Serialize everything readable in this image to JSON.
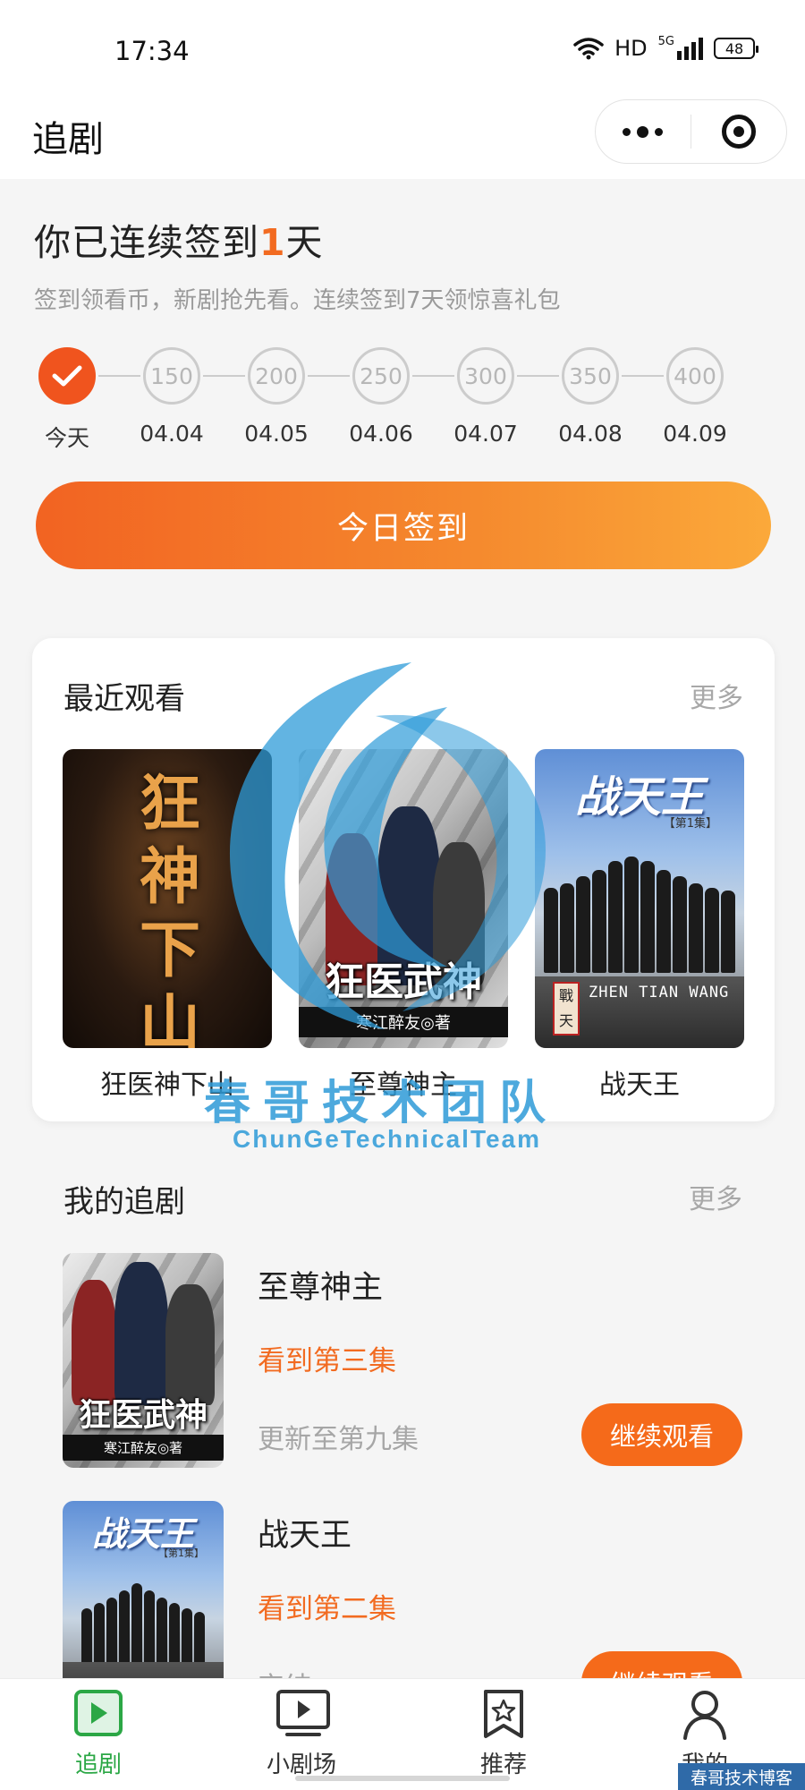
{
  "status_bar": {
    "time": "17:34",
    "network": "HD",
    "signal": "5G",
    "battery": "48"
  },
  "header": {
    "title": "追剧",
    "menu_icon": "more-dots-icon",
    "close_icon": "target-icon"
  },
  "signin": {
    "title_prefix": "你已连续签到",
    "days": "1",
    "title_suffix": "天",
    "subtitle": "签到领看币，新剧抢先看。连续签到7天领惊喜礼包",
    "days_list": [
      {
        "label": "今天",
        "value": "",
        "done": true
      },
      {
        "label": "04.04",
        "value": "150",
        "done": false
      },
      {
        "label": "04.05",
        "value": "200",
        "done": false
      },
      {
        "label": "04.06",
        "value": "250",
        "done": false
      },
      {
        "label": "04.07",
        "value": "300",
        "done": false
      },
      {
        "label": "04.08",
        "value": "350",
        "done": false
      },
      {
        "label": "04.09",
        "value": "400",
        "done": false
      }
    ],
    "button": "今日签到",
    "accent": "#f26b21"
  },
  "recent": {
    "title": "最近观看",
    "more": "更多",
    "items": [
      {
        "name": "狂医神下山",
        "poster_text": "狂神下山"
      },
      {
        "name": "至尊神主",
        "poster_title": "狂医武神",
        "poster_author": "寒江醉友◎著"
      },
      {
        "name": "战天王",
        "poster_title": "战天王",
        "poster_ep": "【第1集】",
        "poster_en": "ZHEN TIAN WANG",
        "poster_seal": "戰天"
      }
    ]
  },
  "mine": {
    "title": "我的追剧",
    "more": "更多",
    "items": [
      {
        "name": "至尊神主",
        "progress": "看到第三集",
        "update": "更新至第九集",
        "button": "继续观看",
        "poster_title": "狂医武神",
        "poster_author": "寒江醉友◎著"
      },
      {
        "name": "战天王",
        "progress": "看到第二集",
        "update": "完结",
        "button": "继续观看",
        "poster_title": "战天王",
        "poster_ep": "【第1集】"
      }
    ]
  },
  "watermark": {
    "title": "春哥技术团队",
    "subtitle": "ChunGeTechnicalTeam",
    "corner": "春哥技术博客"
  },
  "tabbar": {
    "items": [
      {
        "label": "追剧",
        "icon": "play-square-icon",
        "active": true
      },
      {
        "label": "小剧场",
        "icon": "tv-play-icon",
        "active": false
      },
      {
        "label": "推荐",
        "icon": "star-bookmark-icon",
        "active": false
      },
      {
        "label": "我的",
        "icon": "person-icon",
        "active": false
      }
    ],
    "active_color": "#2ba745"
  }
}
